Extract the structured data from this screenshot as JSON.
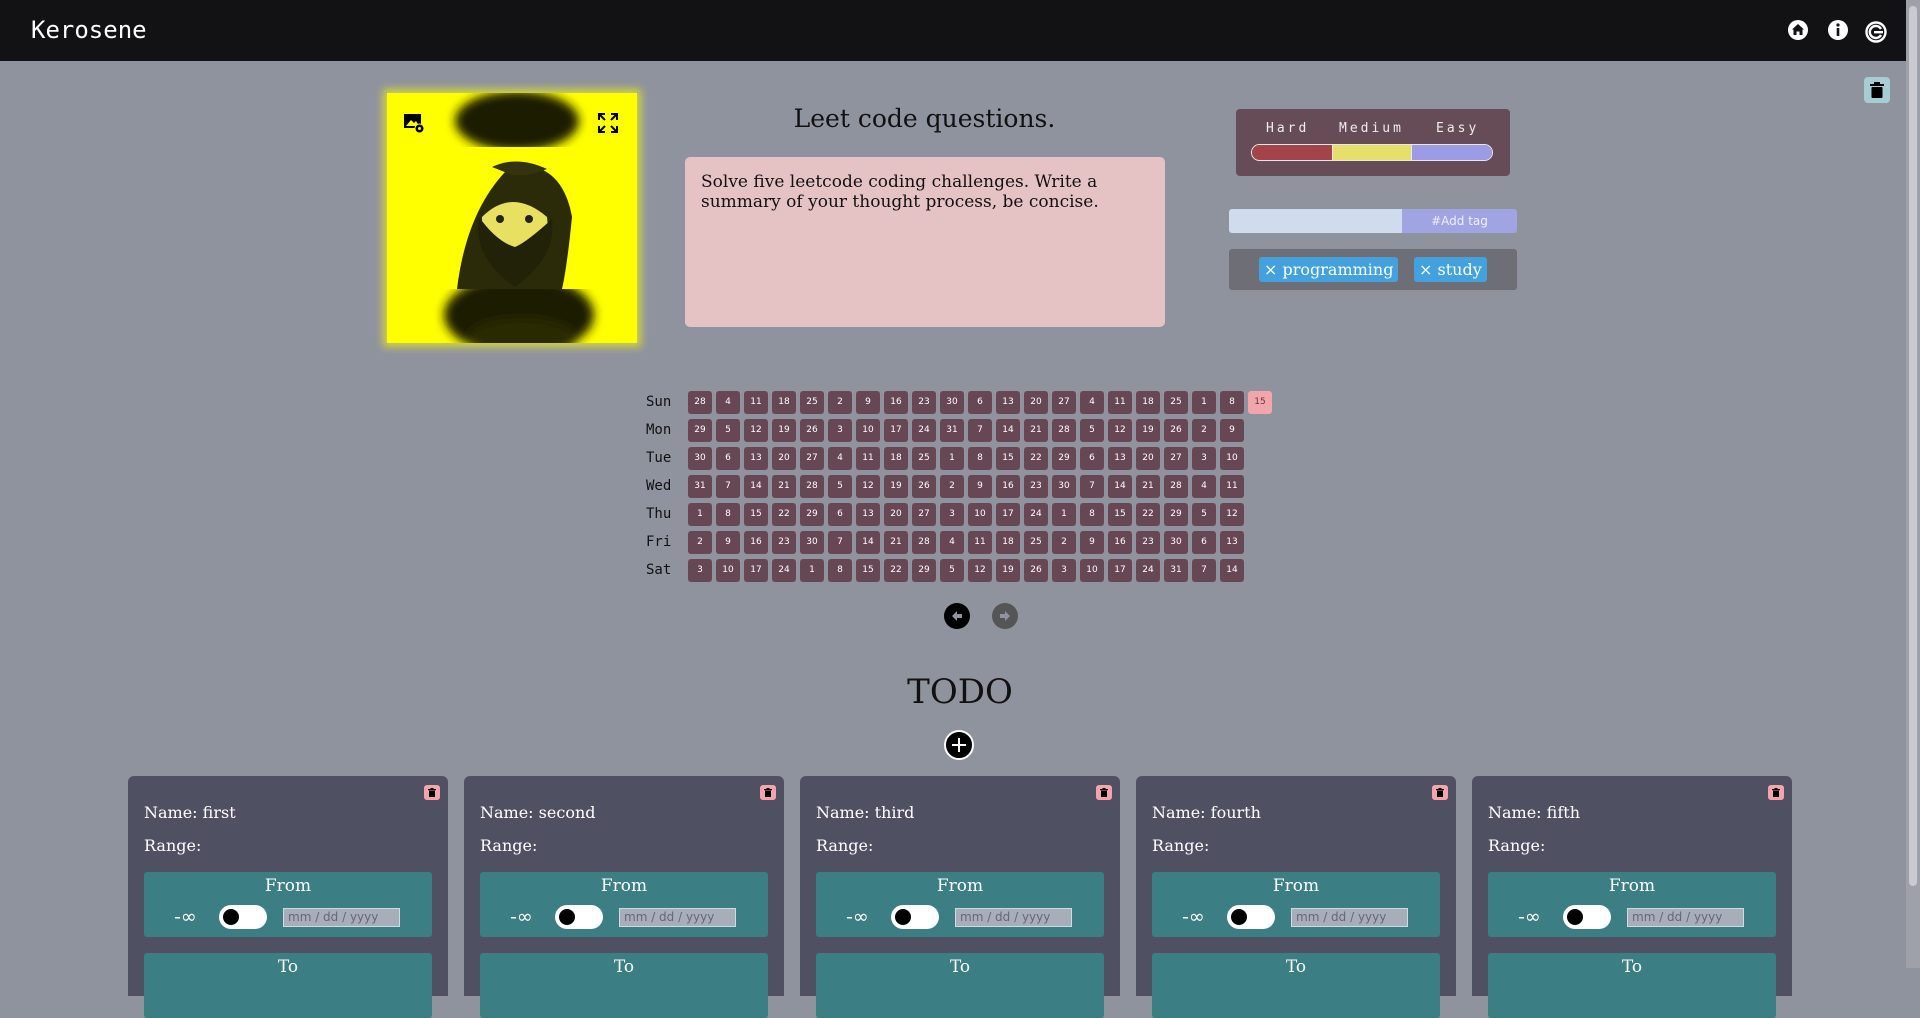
{
  "app": {
    "brand": "Kerosene"
  },
  "nav": [
    "home-icon",
    "info-icon",
    "logout-icon"
  ],
  "page": {
    "delete_icon": "trash-icon"
  },
  "task": {
    "title": "Leet code questions.",
    "description": "Solve five leetcode coding challenges. Write a summary of your thought process, be concise."
  },
  "difficulty": {
    "labels": [
      "Hard",
      "Medium",
      "Easy"
    ],
    "colors": {
      "hard": "#a4434a",
      "medium": "#e6e06b",
      "easy": "#9c9ce6"
    }
  },
  "tags": {
    "input_value": "",
    "add_label": "#Add tag",
    "items": [
      {
        "remove": "×",
        "label": "programming"
      },
      {
        "remove": "×",
        "label": "study"
      }
    ]
  },
  "calendar": {
    "days": [
      "Sun",
      "Mon",
      "Tue",
      "Wed",
      "Thu",
      "Fri",
      "Sat"
    ],
    "weeks": [
      [
        "28",
        "29",
        "30",
        "31",
        "1",
        "2",
        "3"
      ],
      [
        "4",
        "5",
        "6",
        "7",
        "8",
        "9",
        "10"
      ],
      [
        "11",
        "12",
        "13",
        "14",
        "15",
        "16",
        "17"
      ],
      [
        "18",
        "19",
        "20",
        "21",
        "22",
        "23",
        "24"
      ],
      [
        "25",
        "26",
        "27",
        "28",
        "29",
        "30",
        "1"
      ],
      [
        "2",
        "3",
        "4",
        "5",
        "6",
        "7",
        "8"
      ],
      [
        "9",
        "10",
        "11",
        "12",
        "13",
        "14",
        "15"
      ],
      [
        "16",
        "17",
        "18",
        "19",
        "20",
        "21",
        "22"
      ],
      [
        "23",
        "24",
        "25",
        "26",
        "27",
        "28",
        "29"
      ],
      [
        "30",
        "31",
        "1",
        "2",
        "3",
        "4",
        "5"
      ],
      [
        "6",
        "7",
        "8",
        "9",
        "10",
        "11",
        "12"
      ],
      [
        "13",
        "14",
        "15",
        "16",
        "17",
        "18",
        "19"
      ],
      [
        "20",
        "21",
        "22",
        "23",
        "24",
        "25",
        "26"
      ],
      [
        "27",
        "28",
        "29",
        "30",
        "1",
        "2",
        "3"
      ],
      [
        "4",
        "5",
        "6",
        "7",
        "8",
        "9",
        "10"
      ],
      [
        "11",
        "12",
        "13",
        "14",
        "15",
        "16",
        "17"
      ],
      [
        "18",
        "19",
        "20",
        "21",
        "22",
        "23",
        "24"
      ],
      [
        "25",
        "26",
        "27",
        "28",
        "29",
        "30",
        "31"
      ],
      [
        "1",
        "2",
        "3",
        "4",
        "5",
        "6",
        "7"
      ],
      [
        "8",
        "9",
        "10",
        "11",
        "12",
        "13",
        "14"
      ],
      [
        "15"
      ]
    ],
    "highlighted": "15"
  },
  "todo": {
    "title": "TODO",
    "name_label": "Name:",
    "range_label": "Range:",
    "from_label": "From",
    "to_label": "To",
    "neg_infinity": "-∞",
    "date_placeholder": "mm / dd / yyyy",
    "items": [
      {
        "name": "first"
      },
      {
        "name": "second"
      },
      {
        "name": "third"
      },
      {
        "name": "fourth"
      },
      {
        "name": "fifth"
      }
    ]
  }
}
